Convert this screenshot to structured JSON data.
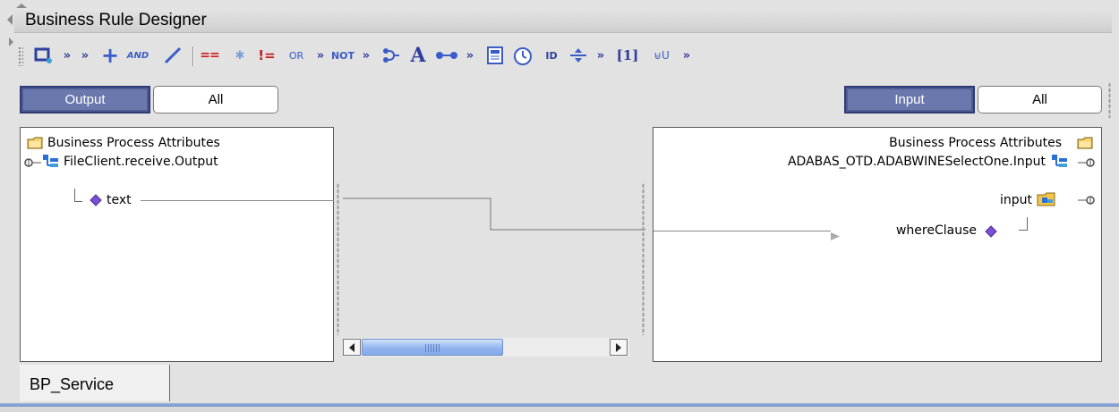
{
  "designer": {
    "title": "Business Rule Designer"
  },
  "toolbar": {
    "items": [
      {
        "name": "link-rule-icon",
        "kind": "svg"
      },
      {
        "name": "more-chevron-1",
        "text": "»"
      },
      {
        "name": "more-chevron-2",
        "text": "»"
      },
      {
        "name": "plus-icon",
        "text": "+"
      },
      {
        "name": "and-operator",
        "text": "AND"
      },
      {
        "name": "divide-icon",
        "text": "/"
      },
      {
        "name": "equals-operator",
        "text": "=="
      },
      {
        "name": "asterisk-icon",
        "text": "✱"
      },
      {
        "name": "not-equals-operator",
        "text": "!="
      },
      {
        "name": "or-operator",
        "text": "OR"
      },
      {
        "name": "more-chevron-3",
        "text": "»"
      },
      {
        "name": "not-operator",
        "text": "NOT"
      },
      {
        "name": "more-chevron-4",
        "text": "»"
      },
      {
        "name": "branch-icon",
        "kind": "svg"
      },
      {
        "name": "string-icon",
        "text": "A"
      },
      {
        "name": "connect-icon",
        "kind": "svg"
      },
      {
        "name": "more-chevron-5",
        "text": "»"
      },
      {
        "name": "document-icon",
        "kind": "svg"
      },
      {
        "name": "clock-icon",
        "kind": "svg"
      },
      {
        "name": "id-icon",
        "text": "ID"
      },
      {
        "name": "split-icon",
        "kind": "svg"
      },
      {
        "name": "more-chevron-6",
        "text": "»"
      },
      {
        "name": "array-index",
        "text": "[1]"
      },
      {
        "name": "concat-icon",
        "text": "⊌U"
      },
      {
        "name": "more-chevron-7",
        "text": "»"
      }
    ]
  },
  "filters": {
    "left_selected": "Output",
    "left_other": "All",
    "right_selected": "Input",
    "right_other": "All"
  },
  "left_tree": {
    "root": "Business Process Attributes",
    "node": "FileClient.receive.Output",
    "leaf": "text"
  },
  "right_tree": {
    "root": "Business Process Attributes",
    "node": "ADABAS_OTD.ADABWINESelectOne.Input",
    "child": "input",
    "leaf": "whereClause"
  },
  "tabs": {
    "active": "BP_Service"
  },
  "colors": {
    "accent": "#6b78ae",
    "toolbar_text": "#2f3f9c",
    "scroll_thumb": "#92b4ef",
    "tree_node_blue": "#2b6fd8",
    "diamond": "#7b4fd1"
  }
}
